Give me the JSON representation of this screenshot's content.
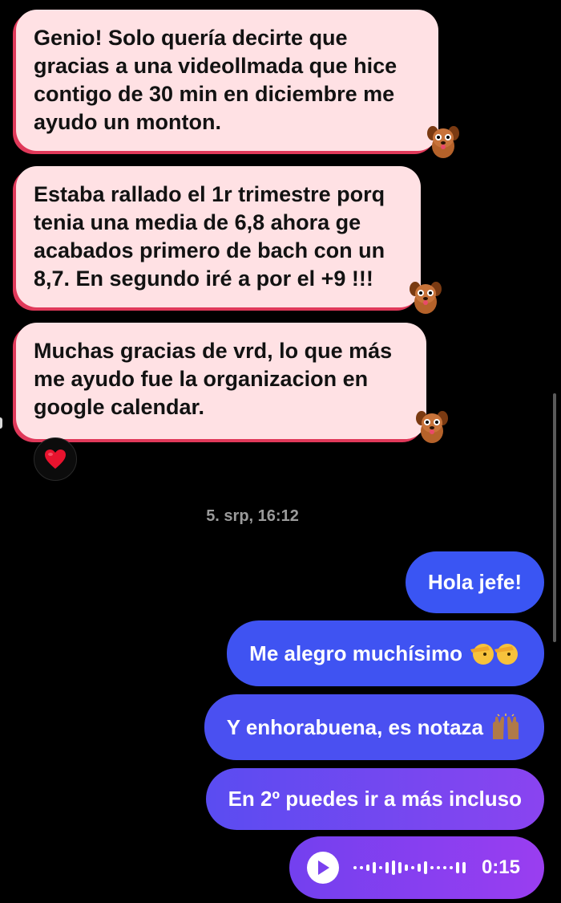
{
  "incoming": [
    {
      "text": "Genio! Solo quería decirte que gracias a una videollmada que hice contigo de 30 min en diciembre me ayudo un monton."
    },
    {
      "text": "Estaba rallado el 1r trimestre porq tenia una media de 6,8 ahora ge acabados primero de bach con un 8,7. En segundo iré a por el +9 !!!"
    },
    {
      "text": "Muchas gracias de vrd, lo que más me ayudo fue la organizacion en google calendar."
    }
  ],
  "reaction": {
    "icon": "red-heart-icon"
  },
  "timestamp": "5. srp, 16:12",
  "outgoing": [
    {
      "text": "Hola jefe!"
    },
    {
      "text": "Me alegro muchísimo",
      "icon": "saluting-face-icon"
    },
    {
      "text": "Y enhorabuena, es notaza",
      "icon": "raising-hands-icon"
    },
    {
      "text": "En 2º puedes ir a más incluso"
    }
  ],
  "voice_message": {
    "duration": "0:15",
    "icon": "play-icon"
  },
  "colors": {
    "incoming_bg": "#ffe1e4",
    "incoming_border": "#e0395a",
    "outgoing_top": "#3a55f3",
    "outgoing_bottom": "#8e3df0"
  }
}
